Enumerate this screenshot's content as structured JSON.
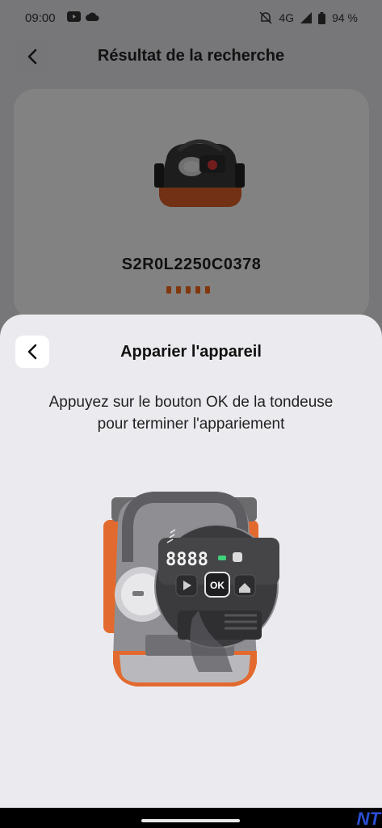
{
  "status_bar": {
    "time": "09:00",
    "network": "4G",
    "battery": "94 %"
  },
  "background_page": {
    "title": "Résultat de la recherche",
    "device_serial": "S2R0L2250C0378"
  },
  "sheet": {
    "title": "Apparier l'appareil",
    "message_line1": "Appuyez sur le bouton OK de la tondeuse",
    "message_line2": "pour terminer l'appariement",
    "display_digits": "8888",
    "ok_label": "OK"
  },
  "watermark": "NT",
  "colors": {
    "accent": "#ff6a1a",
    "sheet_bg": "#ebebef",
    "dark_text": "#111111"
  },
  "icons": [
    "youtube-icon",
    "cloud-icon",
    "mute-icon",
    "signal-icon",
    "battery-icon",
    "chevron-left-icon"
  ]
}
